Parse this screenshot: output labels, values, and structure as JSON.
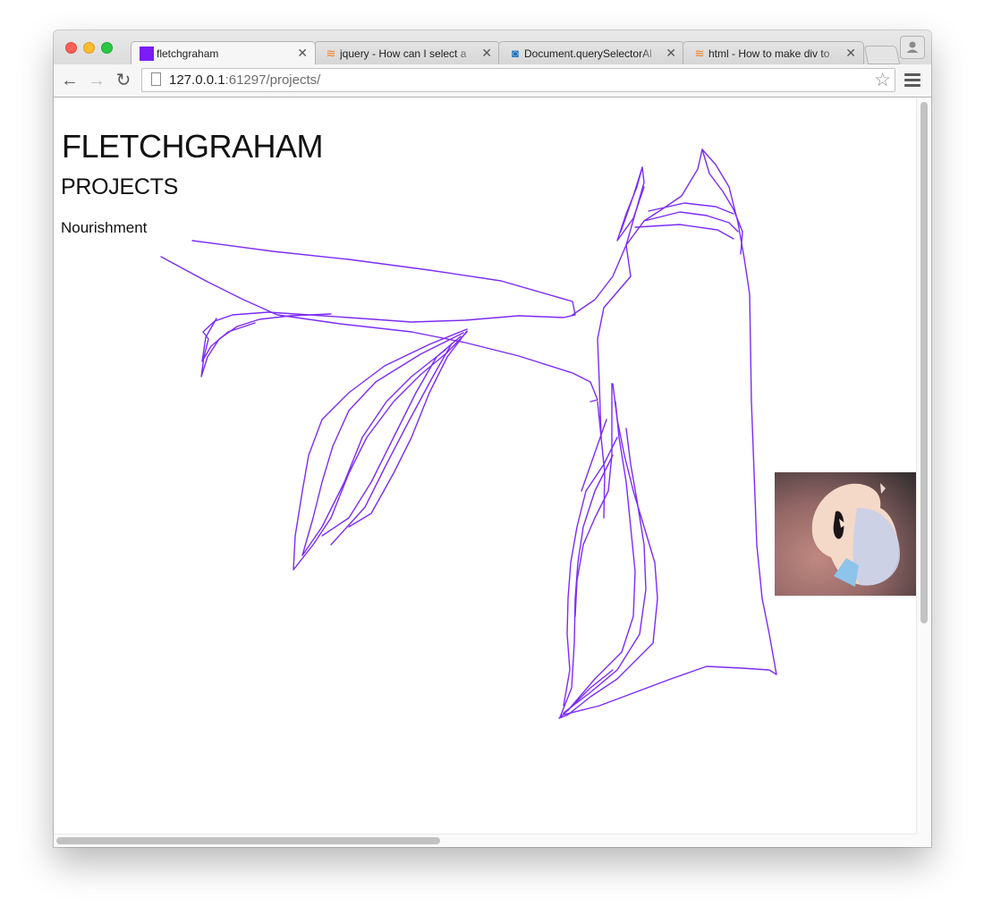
{
  "window": {
    "tabs": [
      {
        "title": "fletchgraham",
        "favicon": "purple-square-icon",
        "active": true
      },
      {
        "title": "jquery - How can I select a",
        "favicon": "stackoverflow-icon",
        "active": false
      },
      {
        "title": "Document.querySelectorAl",
        "favicon": "mdn-icon",
        "active": false
      },
      {
        "title": "html - How to make div to",
        "favicon": "stackoverflow-icon",
        "active": false
      }
    ],
    "close_glyph": "✕"
  },
  "toolbar": {
    "back_glyph": "←",
    "forward_glyph": "→",
    "reload_glyph": "↻",
    "url_host": "127.0.0.1",
    "url_rest": ":61297/projects/",
    "star_glyph": "☆"
  },
  "page": {
    "site_title": "FLETCHGRAHAM",
    "section_title": "PROJECTS",
    "projects": [
      "Nourishment"
    ],
    "accent_color": "#7b2cf7"
  }
}
